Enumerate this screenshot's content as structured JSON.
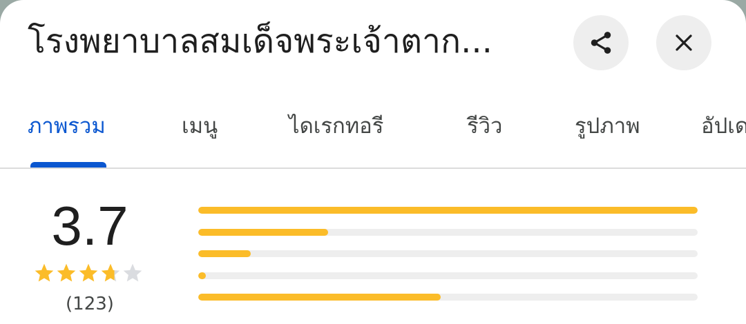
{
  "header": {
    "title": "โรงพยาบาลสมเด็จพระเจ้าตาก...",
    "share_icon": "share-icon",
    "close_icon": "close-icon"
  },
  "tabs": [
    {
      "label": "ภาพรวม",
      "active": true
    },
    {
      "label": "เมนู",
      "active": false
    },
    {
      "label": "ไดเรกทอรี",
      "active": false
    },
    {
      "label": "รีวิว",
      "active": false
    },
    {
      "label": "รูปภาพ",
      "active": false
    },
    {
      "label": "อัปเด",
      "active": false
    }
  ],
  "rating": {
    "value": "3.7",
    "stars_value": 3.7,
    "stars_max": 5,
    "review_count": "(123)",
    "distribution": [
      {
        "stars": 5,
        "fraction": 1.0
      },
      {
        "stars": 4,
        "fraction": 0.26
      },
      {
        "stars": 3,
        "fraction": 0.105
      },
      {
        "stars": 2,
        "fraction": 0.015
      },
      {
        "stars": 1,
        "fraction": 0.485
      }
    ]
  },
  "colors": {
    "accent": "#0b57d0",
    "star": "#fbbc29",
    "star_empty": "#dadce0",
    "bar_track": "#eeeeee"
  }
}
